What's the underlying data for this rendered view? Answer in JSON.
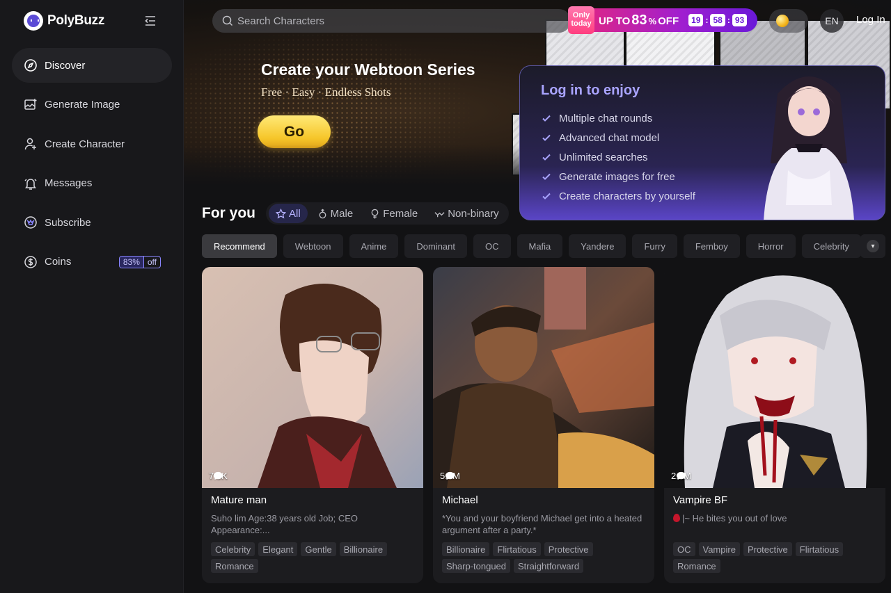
{
  "brand": {
    "name": "PolyBuzz"
  },
  "sidebar": {
    "items": [
      {
        "label": "Discover",
        "icon": "compass-icon"
      },
      {
        "label": "Generate Image",
        "icon": "image-plus-icon"
      },
      {
        "label": "Create Character",
        "icon": "user-plus-icon"
      },
      {
        "label": "Messages",
        "icon": "bell-icon"
      },
      {
        "label": "Subscribe",
        "icon": "crown-badge-icon"
      },
      {
        "label": "Coins",
        "icon": "dollar-coin-icon"
      }
    ],
    "coins_badge": {
      "percent": "83%",
      "suffix": "off"
    }
  },
  "header": {
    "search_placeholder": "Search Characters",
    "promo": {
      "tag": "Only today",
      "prefix": "UP TO",
      "percent": "83",
      "percent_sign": "%",
      "suffix": "OFF",
      "timer": [
        "19",
        "58",
        "93"
      ]
    },
    "language": "EN",
    "login": "Log In"
  },
  "hero": {
    "title": "Create your Webtoon Series",
    "subtitle": "Free · Easy · Endless Shots",
    "cta": "Go"
  },
  "login_popup": {
    "title": "Log in to enjoy",
    "benefits": [
      "Multiple chat rounds",
      "Advanced chat model",
      "Unlimited searches",
      "Generate images for free",
      "Create characters by yourself"
    ]
  },
  "for_you": {
    "title": "For you",
    "gender_tabs": [
      "All",
      "Male",
      "Female",
      "Non-binary"
    ],
    "categories": [
      "Recommend",
      "Webtoon",
      "Anime",
      "Dominant",
      "OC",
      "Mafia",
      "Yandere",
      "Furry",
      "Femboy",
      "Horror",
      "Celebrity"
    ]
  },
  "cards": [
    {
      "count": "7.5K",
      "name": "Mature man",
      "description": "Suho lim Age:38 years old Job; CEO Appearance:...",
      "tags": [
        "Celebrity",
        "Elegant",
        "Gentle",
        "Billionaire",
        "Romance"
      ]
    },
    {
      "count": "5.5M",
      "name": "Michael",
      "description": "*You and your boyfriend Michael get into a heated argument after a party.*",
      "tags": [
        "Billionaire",
        "Flirtatious",
        "Protective",
        "Sharp-tongued",
        "Straightforward"
      ]
    },
    {
      "count": "2.2M",
      "name": "Vampire BF",
      "description": "|~ He bites you out of love",
      "tags": [
        "OC",
        "Vampire",
        "Protective",
        "Flirtatious",
        "Romance"
      ]
    }
  ]
}
